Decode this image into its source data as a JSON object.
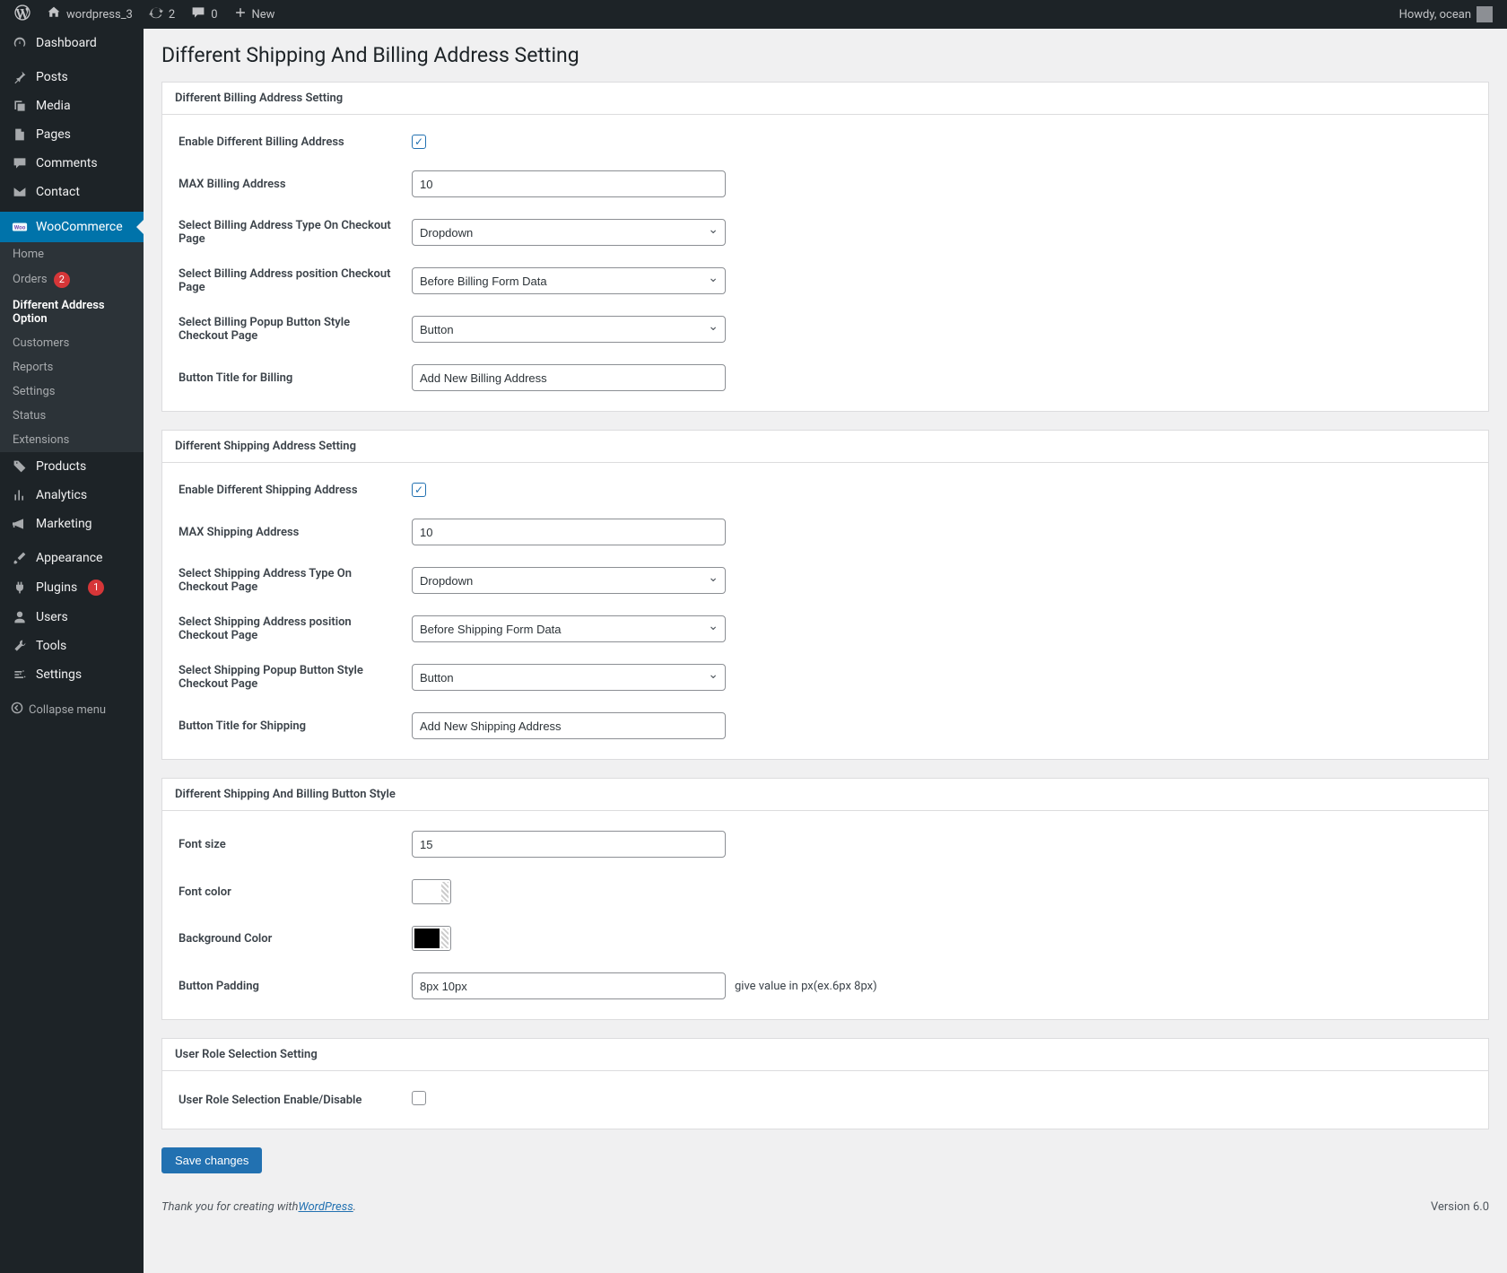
{
  "adminbar": {
    "site_name": "wordpress_3",
    "updates": "2",
    "comments": "0",
    "new_label": "New",
    "greeting": "Howdy, ocean"
  },
  "sidebar": {
    "dashboard": "Dashboard",
    "posts": "Posts",
    "media": "Media",
    "pages": "Pages",
    "comments": "Comments",
    "contact": "Contact",
    "woocommerce": "WooCommerce",
    "woo_sub": {
      "home": "Home",
      "orders": "Orders",
      "orders_badge": "2",
      "diff_addr": "Different Address Option",
      "customers": "Customers",
      "reports": "Reports",
      "settings": "Settings",
      "status": "Status",
      "extensions": "Extensions"
    },
    "products": "Products",
    "analytics": "Analytics",
    "marketing": "Marketing",
    "appearance": "Appearance",
    "plugins": "Plugins",
    "plugins_badge": "1",
    "users": "Users",
    "tools": "Tools",
    "settings": "Settings",
    "collapse": "Collapse menu"
  },
  "page": {
    "title": "Different Shipping And Billing Address Setting"
  },
  "panels": {
    "billing": {
      "header": "Different Billing Address Setting",
      "enable_label": "Enable Different Billing Address",
      "enable_checked": true,
      "max_label": "MAX Billing Address",
      "max_value": "10",
      "type_label": "Select Billing Address Type On Checkout Page",
      "type_value": "Dropdown",
      "position_label": "Select Billing Address position Checkout Page",
      "position_value": "Before Billing Form Data",
      "popup_label": "Select Billing Popup Button Style Checkout Page",
      "popup_value": "Button",
      "button_title_label": "Button Title for Billing",
      "button_title_value": "Add New Billing Address"
    },
    "shipping": {
      "header": "Different Shipping Address Setting",
      "enable_label": "Enable Different Shipping Address",
      "enable_checked": true,
      "max_label": "MAX Shipping Address",
      "max_value": "10",
      "type_label": "Select Shipping Address Type On Checkout Page",
      "type_value": "Dropdown",
      "position_label": "Select Shipping Address position Checkout Page",
      "position_value": "Before Shipping Form Data",
      "popup_label": "Select Shipping Popup Button Style Checkout Page",
      "popup_value": "Button",
      "button_title_label": "Button Title for Shipping",
      "button_title_value": "Add New Shipping Address"
    },
    "style": {
      "header": "Different Shipping And Billing Button Style",
      "font_size_label": "Font size",
      "font_size_value": "15",
      "font_color_label": "Font color",
      "font_color_value": "#ffffff",
      "bg_color_label": "Background Color",
      "bg_color_value": "#000000",
      "padding_label": "Button Padding",
      "padding_value": "8px 10px",
      "padding_help": "give value in px(ex.6px 8px)"
    },
    "userrole": {
      "header": "User Role Selection Setting",
      "enable_label": "User Role Selection Enable/Disable",
      "enable_checked": false
    }
  },
  "actions": {
    "save": "Save changes"
  },
  "footer": {
    "text": "Thank you for creating with ",
    "link": "WordPress",
    "period": ".",
    "version": "Version 6.0"
  }
}
